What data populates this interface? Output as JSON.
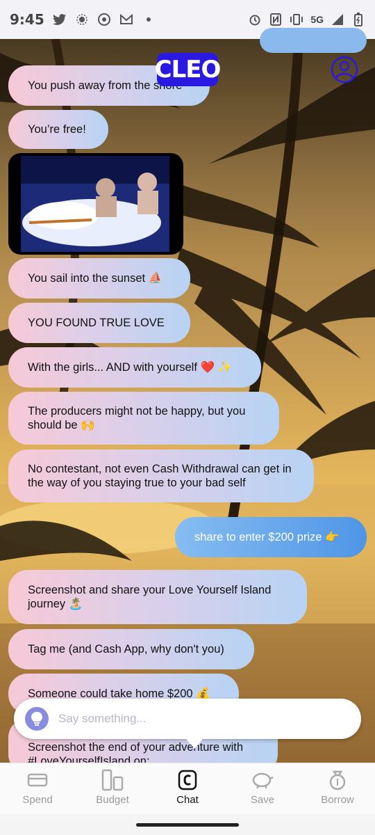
{
  "status_bar": {
    "time": "9:45",
    "network": "5G",
    "icons_left": [
      "twitter-icon",
      "settings-dot-icon",
      "chrome-icon",
      "gmail-icon",
      "dot-icon"
    ],
    "icons_right": [
      "alarm-icon",
      "nfc-icon",
      "vibrate-icon",
      "signal-icon",
      "battery-icon"
    ]
  },
  "header": {
    "logo_text": "CLEO",
    "profile_icon": "profile-icon"
  },
  "chat": {
    "messages": [
      {
        "side": "out",
        "text": ""
      },
      {
        "side": "in",
        "text": "You push away from the shore"
      },
      {
        "side": "in",
        "text": "You’re free!"
      },
      {
        "side": "in",
        "type": "gif",
        "text": ""
      },
      {
        "side": "in",
        "text": "You sail into the sunset ⛵"
      },
      {
        "side": "in",
        "text": "YOU FOUND TRUE LOVE"
      },
      {
        "side": "in",
        "text": "With the girls... AND with yourself ❤️ ✨"
      },
      {
        "side": "in",
        "text": "The producers might not be happy, but you should be 🙌"
      },
      {
        "side": "in",
        "text": "No contestant, not even Cash Withdrawal can get in the way of you staying true to your bad self"
      },
      {
        "side": "out",
        "text": "share to enter $200 prize 👉"
      },
      {
        "side": "in",
        "text": "Screenshot and share your Love Yourself Island journey 🏝️"
      },
      {
        "side": "in",
        "text": "Tag me (and Cash App, why don't you)"
      },
      {
        "side": "in",
        "text": "Someone could take home $200 💰"
      },
      {
        "side": "in",
        "text": "Screenshot the end of your adventure with #LoveYourselfIsland on:"
      }
    ]
  },
  "input": {
    "placeholder": "Say something...",
    "icon": "lightbulb-icon"
  },
  "tabs": [
    {
      "label": "Spend",
      "icon": "card-icon",
      "active": false
    },
    {
      "label": "Budget",
      "icon": "budget-icon",
      "active": false
    },
    {
      "label": "Chat",
      "icon": "chat-c-icon",
      "active": true
    },
    {
      "label": "Save",
      "icon": "piggy-bank-icon",
      "active": false
    },
    {
      "label": "Borrow",
      "icon": "money-bag-icon",
      "active": false
    }
  ],
  "colors": {
    "brand": "#2a19e0",
    "bubble_in_start": "#f7c9d6",
    "bubble_in_end": "#b7d3f4",
    "bubble_out_start": "#86bdf2",
    "bubble_out_end": "#4f95e6"
  }
}
